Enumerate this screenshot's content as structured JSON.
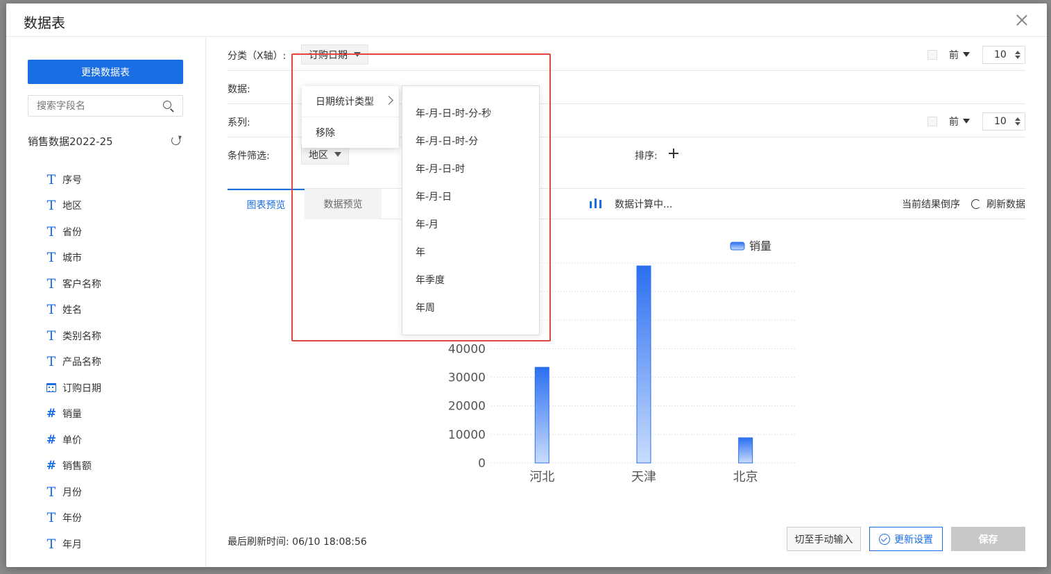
{
  "dialog": {
    "title": "数据表"
  },
  "sidebar": {
    "change_button": "更换数据表",
    "search_placeholder": "搜索字段名",
    "source_name": "销售数据2022-25",
    "fields": [
      {
        "label": "序号",
        "icon": "text-type-icon",
        "type": "text"
      },
      {
        "label": "地区",
        "icon": "text-type-icon",
        "type": "text"
      },
      {
        "label": "省份",
        "icon": "text-type-icon",
        "type": "text"
      },
      {
        "label": "城市",
        "icon": "text-type-icon",
        "type": "text"
      },
      {
        "label": "客户名称",
        "icon": "text-type-icon",
        "type": "text"
      },
      {
        "label": "姓名",
        "icon": "text-type-icon",
        "type": "text"
      },
      {
        "label": "类别名称",
        "icon": "text-type-icon",
        "type": "text"
      },
      {
        "label": "产品名称",
        "icon": "text-type-icon",
        "type": "text"
      },
      {
        "label": "订购日期",
        "icon": "calendar-icon",
        "type": "date"
      },
      {
        "label": "销量",
        "icon": "number-type-icon",
        "type": "number"
      },
      {
        "label": "单价",
        "icon": "number-type-icon",
        "type": "number"
      },
      {
        "label": "销售额",
        "icon": "number-type-icon",
        "type": "number"
      },
      {
        "label": "月份",
        "icon": "text-type-icon",
        "type": "text"
      },
      {
        "label": "年份",
        "icon": "text-type-icon",
        "type": "text"
      },
      {
        "label": "年月",
        "icon": "text-type-icon",
        "type": "text"
      }
    ]
  },
  "config": {
    "category_label": "分类（X轴）:",
    "category_value": "订购日期",
    "data_label": "数据:",
    "series_label": "系列:",
    "filter_label": "条件筛选:",
    "filter_value": "地区",
    "sort_label": "排序:",
    "top_label": "前",
    "top_n_category": "10",
    "top_n_series": "10"
  },
  "tabs": {
    "chart_preview": "图表预览",
    "data_preview": "数据预览",
    "calc_status": "数据计算中...",
    "reverse": "当前结果倒序",
    "refresh": "刷新数据"
  },
  "context_menu": {
    "items": [
      "日期统计类型",
      "移除"
    ]
  },
  "date_submenu": {
    "items": [
      "年-月-日-时-分-秒",
      "年-月-日-时-分",
      "年-月-日-时",
      "年-月-日",
      "年-月",
      "年",
      "年季度",
      "年周"
    ]
  },
  "footer": {
    "last_refresh": "最后刷新时间: 06/10 18:08:56",
    "manual_input": "切至手动输入",
    "update_settings": "更新设置",
    "save": "保存"
  },
  "colors": {
    "accent": "#1a6ee3",
    "highlight": "#e0483f"
  },
  "chart_data": {
    "type": "bar",
    "categories": [
      "河北",
      "天津",
      "北京"
    ],
    "series": [
      {
        "name": "销量",
        "values": [
          33500,
          69000,
          8800
        ]
      }
    ],
    "yticks": [
      0,
      10000,
      20000,
      30000,
      40000
    ],
    "ylim": [
      0,
      70000
    ],
    "legend": "top-right",
    "grid": true
  }
}
